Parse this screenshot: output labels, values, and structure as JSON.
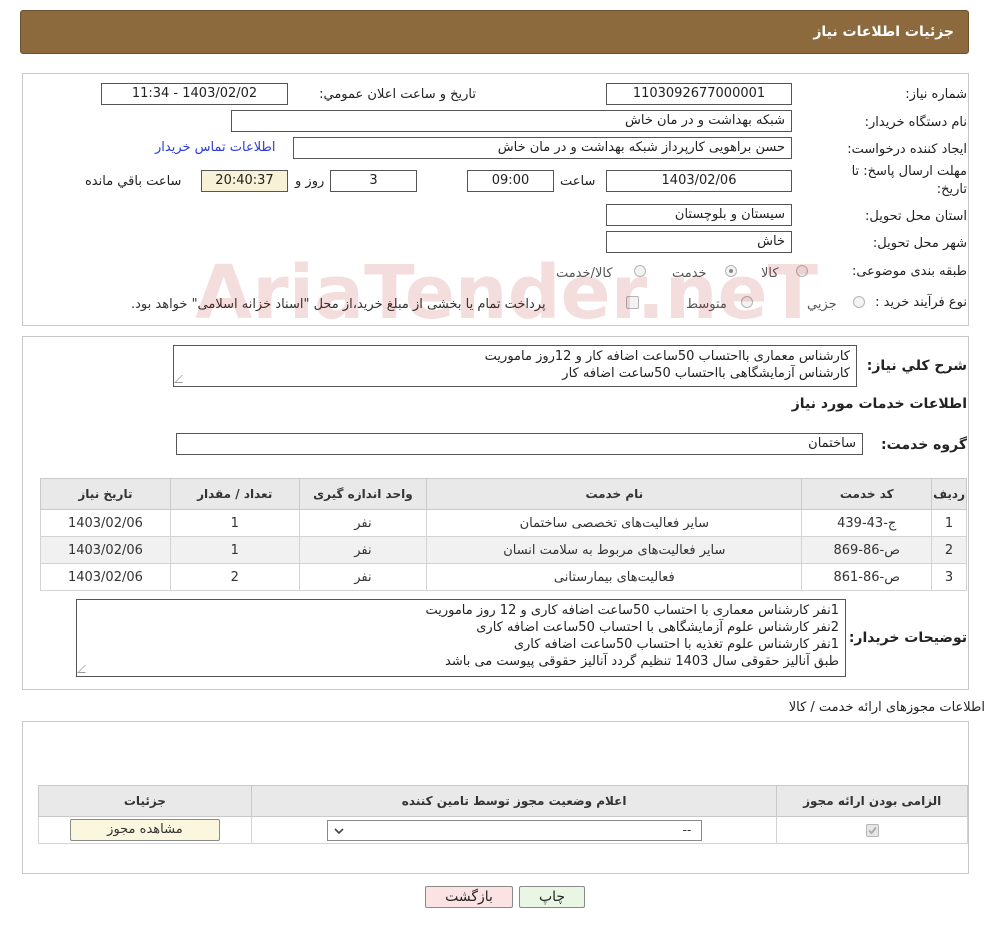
{
  "header": {
    "title": "جزئیات اطلاعات نیاز"
  },
  "info": {
    "need_number_label": "شماره نیاز:",
    "need_number": "1103092677000001",
    "announce_label": "تاریخ و ساعت اعلان عمومي:",
    "announce_value": "1403/02/02 - 11:34",
    "buyer_org_label": "نام دستگاه خریدار:",
    "buyer_org": "شبکه بهداشت و در مان خاش",
    "creator_label": "ایجاد کننده درخواست:",
    "creator": "حسن براهویی کارپرداز شبکه بهداشت و در مان خاش",
    "contact_link": "اطلاعات تماس خریدار",
    "deadline_label_1": "مهلت ارسال پاسخ: تا",
    "deadline_label_2": "تاریخ:",
    "deadline_date": "1403/02/06",
    "time_label": "ساعت",
    "deadline_time": "09:00",
    "days_value": "3",
    "days_label": "روز و",
    "remaining_value": "20:40:37",
    "remaining_label": "ساعت باقي مانده",
    "province_label": "استان محل تحویل:",
    "province": "سیستان و بلوچستان",
    "city_label": "شهر محل تحویل:",
    "city": "خاش",
    "category_label": "طبقه بندی موضوعی:",
    "category_options": [
      "کالا",
      "خدمت",
      "کالا/خدمت"
    ],
    "category_selected": "خدمت",
    "purchase_type_label": "نوع فرآیند خرید :",
    "purchase_options": [
      "جزیي",
      "متوسط"
    ],
    "purchase_selected": "متوسط",
    "treasury_note": "پرداخت تمام یا بخشی از مبلغ خرید،از محل \"اسناد خزانه اسلامی\" خواهد بود."
  },
  "services": {
    "summary_label": "شرح كلي نياز:",
    "summary_lines": [
      "کارشناس معماری بااحتساب 50ساعت اضافه کار و 12روز ماموریت",
      "کارشناس آزمایشگاهی بااحتساب 50ساعت اضافه کار"
    ],
    "section_title": "اطلاعات خدمات مورد نیاز",
    "group_label": "گروه خدمت:",
    "group_value": "ساختمان",
    "columns": [
      "رديف",
      "کد خدمت",
      "نام خدمت",
      "واحد اندازه گیری",
      "تعداد / مقدار",
      "تاریخ نیاز"
    ],
    "rows": [
      {
        "idx": "1",
        "code": "ج-43-439",
        "name": "سایر فعالیت‌های تخصصی ساختمان",
        "unit": "نفر",
        "qty": "1",
        "date": "1403/02/06"
      },
      {
        "idx": "2",
        "code": "ص-86-869",
        "name": "سایر فعالیت‌های مربوط به سلامت انسان",
        "unit": "نفر",
        "qty": "1",
        "date": "1403/02/06"
      },
      {
        "idx": "3",
        "code": "ص-86-861",
        "name": "فعالیت‌های بیمارستانی",
        "unit": "نفر",
        "qty": "2",
        "date": "1403/02/06"
      }
    ],
    "buyer_notes_label": "توضیحات خریدار:",
    "buyer_notes_lines": [
      "1نفر کارشناس معماری با احتساب 50ساعت اضافه کاری و 12 روز ماموریت",
      "2نفر کارشناس علوم آزمایشگاهی با احتساب 50ساعت اضافه کاری",
      "1نفر کارشناس علوم تغذیه با احتساب 50ساعت اضافه کاری",
      "طبق آنالیز حقوقی سال 1403 تنظیم گردد آنالیز حقوقی پیوست می باشد"
    ]
  },
  "permits": {
    "section_title": "اطلاعات مجوزهای ارائه خدمت / کالا",
    "columns": [
      "الزامی بودن ارائه مجوز",
      "اعلام وضعیت مجوز توسط تامین کننده",
      "جزئیات"
    ],
    "select_value": "--",
    "view_button": "مشاهده مجوز"
  },
  "footer": {
    "print_button": "چاپ",
    "back_button": "بازگشت"
  },
  "watermark": {
    "text": "AriaTender.neT"
  }
}
